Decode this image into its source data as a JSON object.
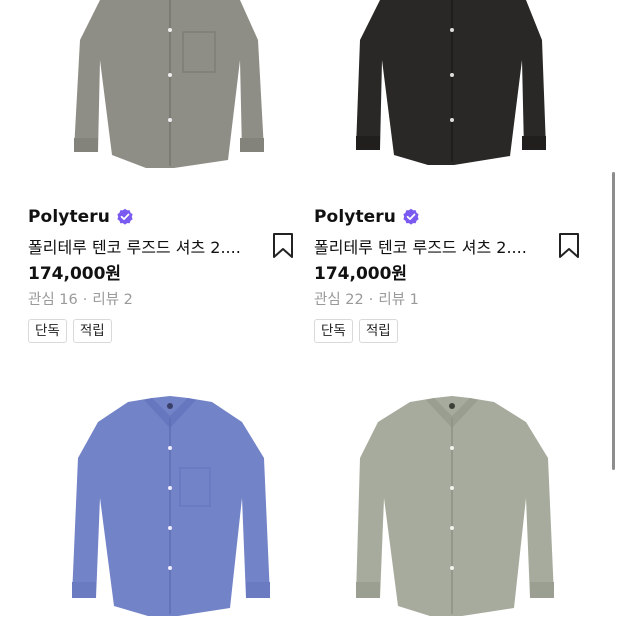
{
  "products": [
    {
      "image_icon": "shirt-grey-icon",
      "color": "#8f8e86",
      "brand": "Polyteru",
      "title": "폴리테루 텐코 루즈드 셔츠 2....",
      "price": "174,000원",
      "likes": "관심 16",
      "separator": "·",
      "reviews": "리뷰 2",
      "badges": [
        "단독",
        "적립"
      ]
    },
    {
      "image_icon": "shirt-black-icon",
      "color": "#2a2826",
      "brand": "Polyteru",
      "title": "폴리테루 텐코 루즈드 셔츠 2....",
      "price": "174,000원",
      "likes": "관심 22",
      "separator": "·",
      "reviews": "리뷰 1",
      "badges": [
        "단독",
        "적립"
      ]
    },
    {
      "image_icon": "shirt-blue-icon",
      "color": "#7383c8"
    },
    {
      "image_icon": "shirt-sage-icon",
      "color": "#a7ab9d"
    }
  ],
  "verified_color": "#7a5af0"
}
